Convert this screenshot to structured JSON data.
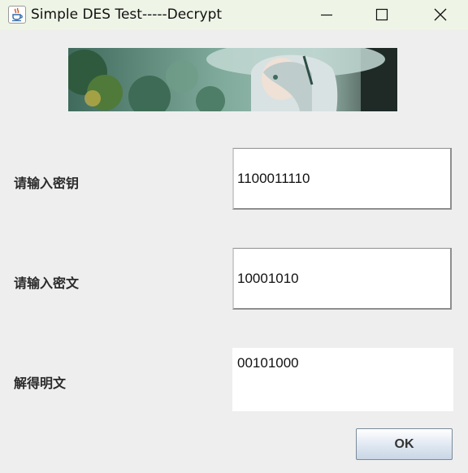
{
  "window": {
    "title": "Simple DES Test-----Decrypt",
    "icons": {
      "app": "java-cup-icon",
      "minimize": "minimize-icon",
      "maximize": "maximize-icon",
      "close": "close-icon"
    }
  },
  "form": {
    "key_label": "请输入密钥",
    "key_value": "1100011110",
    "ciphertext_label": "请输入密文",
    "ciphertext_value": "10001010",
    "plaintext_label": "解得明文",
    "plaintext_value": "00101000"
  },
  "actions": {
    "ok_label": "OK"
  },
  "colors": {
    "titlebar": "#eef4e6",
    "background": "#eeeeee",
    "button_gradient_end": "#c9d6e5"
  }
}
